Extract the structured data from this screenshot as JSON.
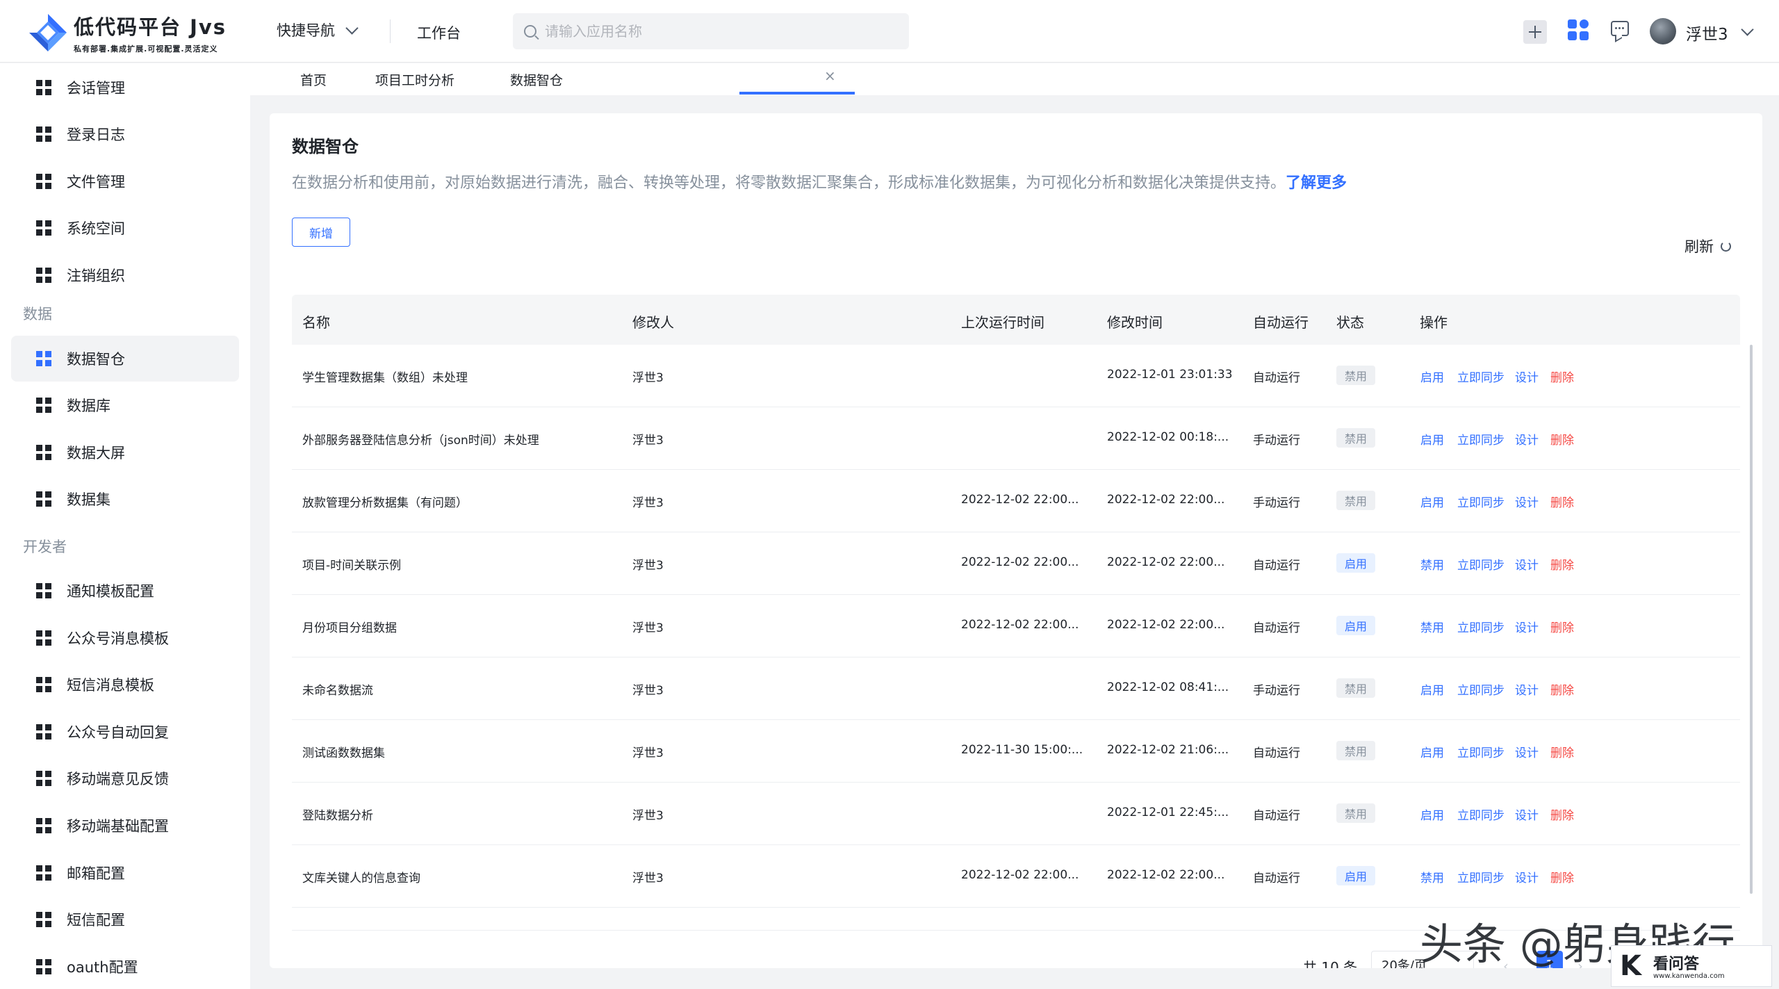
{
  "brand": {
    "title": "低代码平台 Jvs",
    "subtitle": "私有部署.集成扩展.可视配置.灵活定义"
  },
  "header": {
    "quick_nav": "快捷导航",
    "workbench": "工作台",
    "search_placeholder": "请输入应用名称",
    "username": "浮世3"
  },
  "sidebar": {
    "items_top": [
      {
        "label": "会话管理"
      },
      {
        "label": "登录日志"
      },
      {
        "label": "文件管理"
      },
      {
        "label": "系统空间"
      },
      {
        "label": "注销组织"
      }
    ],
    "group_data": "数据",
    "items_data": [
      {
        "label": "数据智仓",
        "active": true
      },
      {
        "label": "数据库"
      },
      {
        "label": "数据大屏"
      },
      {
        "label": "数据集"
      }
    ],
    "group_dev": "开发者",
    "items_dev": [
      {
        "label": "通知模板配置"
      },
      {
        "label": "公众号消息模板"
      },
      {
        "label": "短信消息模板"
      },
      {
        "label": "公众号自动回复"
      },
      {
        "label": "移动端意见反馈"
      },
      {
        "label": "移动端基础配置"
      },
      {
        "label": "邮箱配置"
      },
      {
        "label": "短信配置"
      },
      {
        "label": "oauth配置"
      }
    ]
  },
  "tabs": [
    {
      "label": "首页"
    },
    {
      "label": "项目工时分析"
    },
    {
      "label": "数据智仓",
      "active": true
    }
  ],
  "page": {
    "title": "数据智仓",
    "description": "在数据分析和使用前，对原始数据进行清洗，融合、转换等处理，将零散数据汇聚集合，形成标准化数据集，为可视化分析和数据化决策提供支持。",
    "learn_more": "了解更多",
    "new_button": "新增",
    "refresh": "刷新"
  },
  "table": {
    "columns": [
      "名称",
      "修改人",
      "上次运行时间",
      "修改时间",
      "自动运行",
      "状态",
      "操作"
    ],
    "rows": [
      {
        "name": "学生管理数据集（数组）未处理",
        "modifier": "浮世3",
        "last_run": "",
        "modified": "2022-12-01 23:01:33",
        "run_mode": "自动运行",
        "status": "禁用",
        "toggle": "启用"
      },
      {
        "name": "外部服务器登陆信息分析（json时间）未处理",
        "modifier": "浮世3",
        "last_run": "",
        "modified": "2022-12-02 00:18:...",
        "run_mode": "手动运行",
        "status": "禁用",
        "toggle": "启用"
      },
      {
        "name": "放款管理分析数据集（有问题）",
        "modifier": "浮世3",
        "last_run": "2022-12-02 22:00...",
        "modified": "2022-12-02 22:00...",
        "run_mode": "手动运行",
        "status": "禁用",
        "toggle": "启用"
      },
      {
        "name": "项目-时间关联示例",
        "modifier": "浮世3",
        "last_run": "2022-12-02 22:00...",
        "modified": "2022-12-02 22:00...",
        "run_mode": "自动运行",
        "status": "启用",
        "toggle": "禁用"
      },
      {
        "name": "月份项目分组数据",
        "modifier": "浮世3",
        "last_run": "2022-12-02 22:00...",
        "modified": "2022-12-02 22:00...",
        "run_mode": "自动运行",
        "status": "启用",
        "toggle": "禁用"
      },
      {
        "name": "未命名数据流",
        "modifier": "浮世3",
        "last_run": "",
        "modified": "2022-12-02 08:41:...",
        "run_mode": "手动运行",
        "status": "禁用",
        "toggle": "启用"
      },
      {
        "name": "测试函数数据集",
        "modifier": "浮世3",
        "last_run": "2022-11-30 15:00:...",
        "modified": "2022-12-02 21:06:...",
        "run_mode": "自动运行",
        "status": "禁用",
        "toggle": "启用"
      },
      {
        "name": "登陆数据分析",
        "modifier": "浮世3",
        "last_run": "",
        "modified": "2022-12-01 22:45:...",
        "run_mode": "自动运行",
        "status": "禁用",
        "toggle": "启用"
      },
      {
        "name": "文库关键人的信息查询",
        "modifier": "浮世3",
        "last_run": "2022-12-02 22:00...",
        "modified": "2022-12-02 22:00...",
        "run_mode": "自动运行",
        "status": "启用",
        "toggle": "禁用"
      }
    ],
    "actions": {
      "sync": "立即同步",
      "design": "设计",
      "delete": "删除"
    }
  },
  "pagination": {
    "total": "共 10 条",
    "page_size": "20条/页",
    "current_page": "1"
  },
  "watermark": {
    "text": "头条 @躬身践行",
    "site_name": "看问答",
    "site_url": "www.kanwenda.com"
  },
  "colors": {
    "primary": "#3370ff",
    "danger": "#f54a45",
    "muted": "#86909c"
  }
}
